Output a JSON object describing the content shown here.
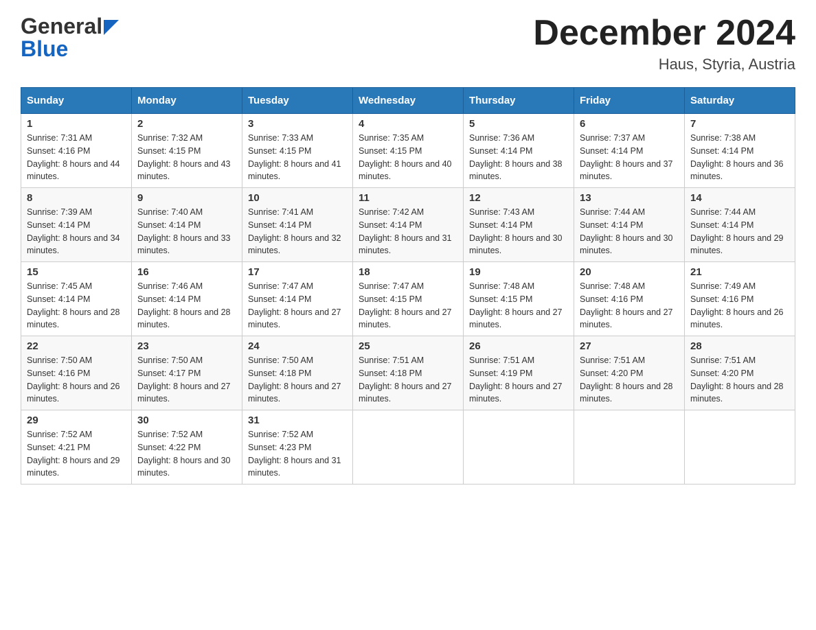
{
  "header": {
    "logo_line1": "General",
    "logo_line2": "Blue",
    "title": "December 2024",
    "subtitle": "Haus, Styria, Austria"
  },
  "weekdays": [
    "Sunday",
    "Monday",
    "Tuesday",
    "Wednesday",
    "Thursday",
    "Friday",
    "Saturday"
  ],
  "weeks": [
    [
      {
        "num": "1",
        "sunrise": "7:31 AM",
        "sunset": "4:16 PM",
        "daylight": "8 hours and 44 minutes."
      },
      {
        "num": "2",
        "sunrise": "7:32 AM",
        "sunset": "4:15 PM",
        "daylight": "8 hours and 43 minutes."
      },
      {
        "num": "3",
        "sunrise": "7:33 AM",
        "sunset": "4:15 PM",
        "daylight": "8 hours and 41 minutes."
      },
      {
        "num": "4",
        "sunrise": "7:35 AM",
        "sunset": "4:15 PM",
        "daylight": "8 hours and 40 minutes."
      },
      {
        "num": "5",
        "sunrise": "7:36 AM",
        "sunset": "4:14 PM",
        "daylight": "8 hours and 38 minutes."
      },
      {
        "num": "6",
        "sunrise": "7:37 AM",
        "sunset": "4:14 PM",
        "daylight": "8 hours and 37 minutes."
      },
      {
        "num": "7",
        "sunrise": "7:38 AM",
        "sunset": "4:14 PM",
        "daylight": "8 hours and 36 minutes."
      }
    ],
    [
      {
        "num": "8",
        "sunrise": "7:39 AM",
        "sunset": "4:14 PM",
        "daylight": "8 hours and 34 minutes."
      },
      {
        "num": "9",
        "sunrise": "7:40 AM",
        "sunset": "4:14 PM",
        "daylight": "8 hours and 33 minutes."
      },
      {
        "num": "10",
        "sunrise": "7:41 AM",
        "sunset": "4:14 PM",
        "daylight": "8 hours and 32 minutes."
      },
      {
        "num": "11",
        "sunrise": "7:42 AM",
        "sunset": "4:14 PM",
        "daylight": "8 hours and 31 minutes."
      },
      {
        "num": "12",
        "sunrise": "7:43 AM",
        "sunset": "4:14 PM",
        "daylight": "8 hours and 30 minutes."
      },
      {
        "num": "13",
        "sunrise": "7:44 AM",
        "sunset": "4:14 PM",
        "daylight": "8 hours and 30 minutes."
      },
      {
        "num": "14",
        "sunrise": "7:44 AM",
        "sunset": "4:14 PM",
        "daylight": "8 hours and 29 minutes."
      }
    ],
    [
      {
        "num": "15",
        "sunrise": "7:45 AM",
        "sunset": "4:14 PM",
        "daylight": "8 hours and 28 minutes."
      },
      {
        "num": "16",
        "sunrise": "7:46 AM",
        "sunset": "4:14 PM",
        "daylight": "8 hours and 28 minutes."
      },
      {
        "num": "17",
        "sunrise": "7:47 AM",
        "sunset": "4:14 PM",
        "daylight": "8 hours and 27 minutes."
      },
      {
        "num": "18",
        "sunrise": "7:47 AM",
        "sunset": "4:15 PM",
        "daylight": "8 hours and 27 minutes."
      },
      {
        "num": "19",
        "sunrise": "7:48 AM",
        "sunset": "4:15 PM",
        "daylight": "8 hours and 27 minutes."
      },
      {
        "num": "20",
        "sunrise": "7:48 AM",
        "sunset": "4:16 PM",
        "daylight": "8 hours and 27 minutes."
      },
      {
        "num": "21",
        "sunrise": "7:49 AM",
        "sunset": "4:16 PM",
        "daylight": "8 hours and 26 minutes."
      }
    ],
    [
      {
        "num": "22",
        "sunrise": "7:50 AM",
        "sunset": "4:16 PM",
        "daylight": "8 hours and 26 minutes."
      },
      {
        "num": "23",
        "sunrise": "7:50 AM",
        "sunset": "4:17 PM",
        "daylight": "8 hours and 27 minutes."
      },
      {
        "num": "24",
        "sunrise": "7:50 AM",
        "sunset": "4:18 PM",
        "daylight": "8 hours and 27 minutes."
      },
      {
        "num": "25",
        "sunrise": "7:51 AM",
        "sunset": "4:18 PM",
        "daylight": "8 hours and 27 minutes."
      },
      {
        "num": "26",
        "sunrise": "7:51 AM",
        "sunset": "4:19 PM",
        "daylight": "8 hours and 27 minutes."
      },
      {
        "num": "27",
        "sunrise": "7:51 AM",
        "sunset": "4:20 PM",
        "daylight": "8 hours and 28 minutes."
      },
      {
        "num": "28",
        "sunrise": "7:51 AM",
        "sunset": "4:20 PM",
        "daylight": "8 hours and 28 minutes."
      }
    ],
    [
      {
        "num": "29",
        "sunrise": "7:52 AM",
        "sunset": "4:21 PM",
        "daylight": "8 hours and 29 minutes."
      },
      {
        "num": "30",
        "sunrise": "7:52 AM",
        "sunset": "4:22 PM",
        "daylight": "8 hours and 30 minutes."
      },
      {
        "num": "31",
        "sunrise": "7:52 AM",
        "sunset": "4:23 PM",
        "daylight": "8 hours and 31 minutes."
      },
      null,
      null,
      null,
      null
    ]
  ]
}
